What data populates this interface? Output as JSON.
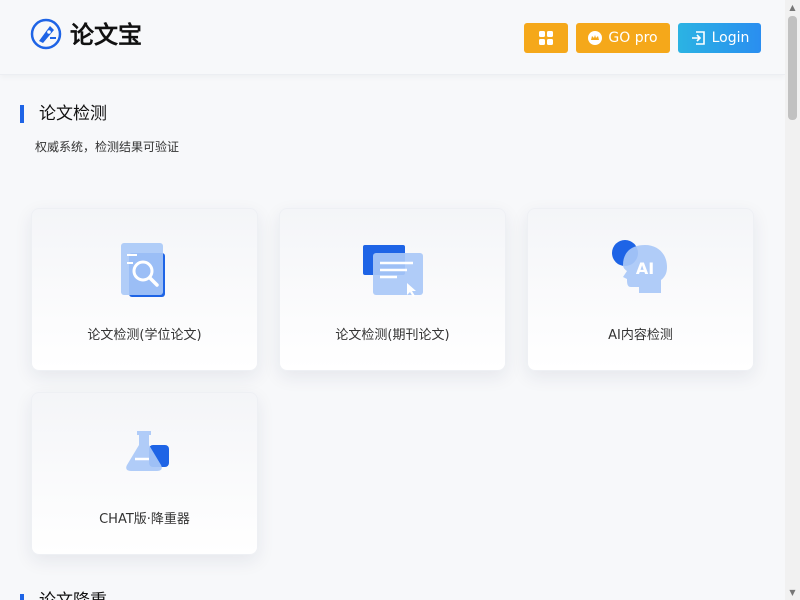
{
  "header": {
    "brand": "论文宝",
    "pro_label": "GO pro",
    "login_label": "Login"
  },
  "sections": [
    {
      "title": "论文检测",
      "subtitle": "权威系统，检测结果可验证"
    },
    {
      "title": "论文降重"
    }
  ],
  "cards": [
    {
      "label": "论文检测(学位论文)",
      "icon": "document-search-icon"
    },
    {
      "label": "论文检测(期刊论文)",
      "icon": "document-cursor-icon"
    },
    {
      "label": "AI内容检测",
      "icon": "ai-head-icon"
    },
    {
      "label": "CHAT版·降重器",
      "icon": "flask-icon"
    }
  ],
  "colors": {
    "accent": "#1e64e6",
    "pro": "#f5a81a",
    "login": "#2a8ef0"
  }
}
